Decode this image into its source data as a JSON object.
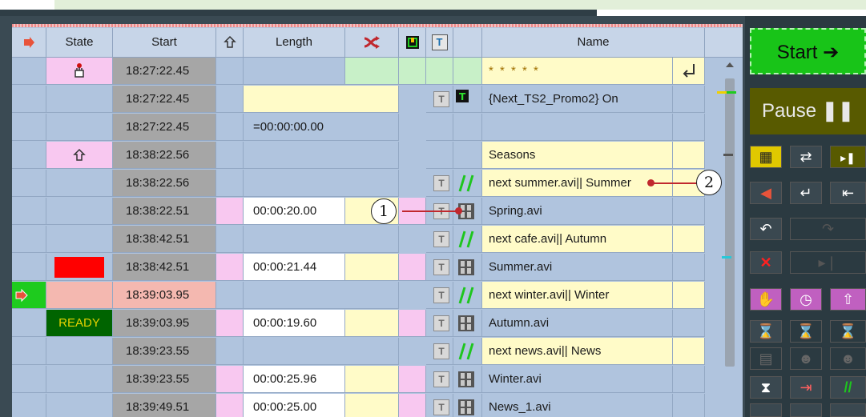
{
  "header": {
    "state": "State",
    "start": "Start",
    "length": "Length",
    "t_label": "T",
    "name": "Name"
  },
  "rows": [
    {
      "state": "",
      "start": "18:27:22.45",
      "length": "",
      "name": "* * * * *"
    },
    {
      "state": "",
      "start": "18:27:22.45",
      "length": "",
      "name": "{Next_TS2_Promo2} On"
    },
    {
      "state": "",
      "start": "18:27:22.45",
      "length": "=00:00:00.00",
      "name": ""
    },
    {
      "state": "",
      "start": "18:38:22.56",
      "length": "",
      "name": "Seasons"
    },
    {
      "state": "",
      "start": "18:38:22.56",
      "length": "",
      "name": "next summer.avi|| Summer"
    },
    {
      "state": "",
      "start": "18:38:22.51",
      "length": "00:00:20.00",
      "name": "Spring.avi"
    },
    {
      "state": "",
      "start": "18:38:42.51",
      "length": "",
      "name": "next cafe.avi|| Autumn"
    },
    {
      "state": "",
      "start": "18:38:42.51",
      "length": "00:00:21.44",
      "name": "Summer.avi"
    },
    {
      "state": "",
      "start": "18:39:03.95",
      "length": "",
      "name": "next winter.avi|| Winter"
    },
    {
      "state": "READY",
      "start": "18:39:03.95",
      "length": "00:00:19.60",
      "name": "Autumn.avi"
    },
    {
      "state": "",
      "start": "18:39:23.55",
      "length": "",
      "name": "next news.avi|| News"
    },
    {
      "state": "",
      "start": "18:39:23.55",
      "length": "00:00:25.96",
      "name": "Winter.avi"
    },
    {
      "state": "",
      "start": "18:39:49.51",
      "length": "00:00:25.00",
      "name": "News_1.avi"
    }
  ],
  "t_button": "T",
  "controls": {
    "start": "Start",
    "pause": "Pause"
  },
  "callouts": [
    "1",
    "2"
  ],
  "colors": {
    "accent_green": "#18c418",
    "ready_bg": "#006400",
    "ready_text": "#e5d200",
    "pause_bg": "#585a00",
    "alert_red": "#ff0000",
    "name_yellow": "#fffbc8",
    "pink": "#f8c8f0"
  }
}
